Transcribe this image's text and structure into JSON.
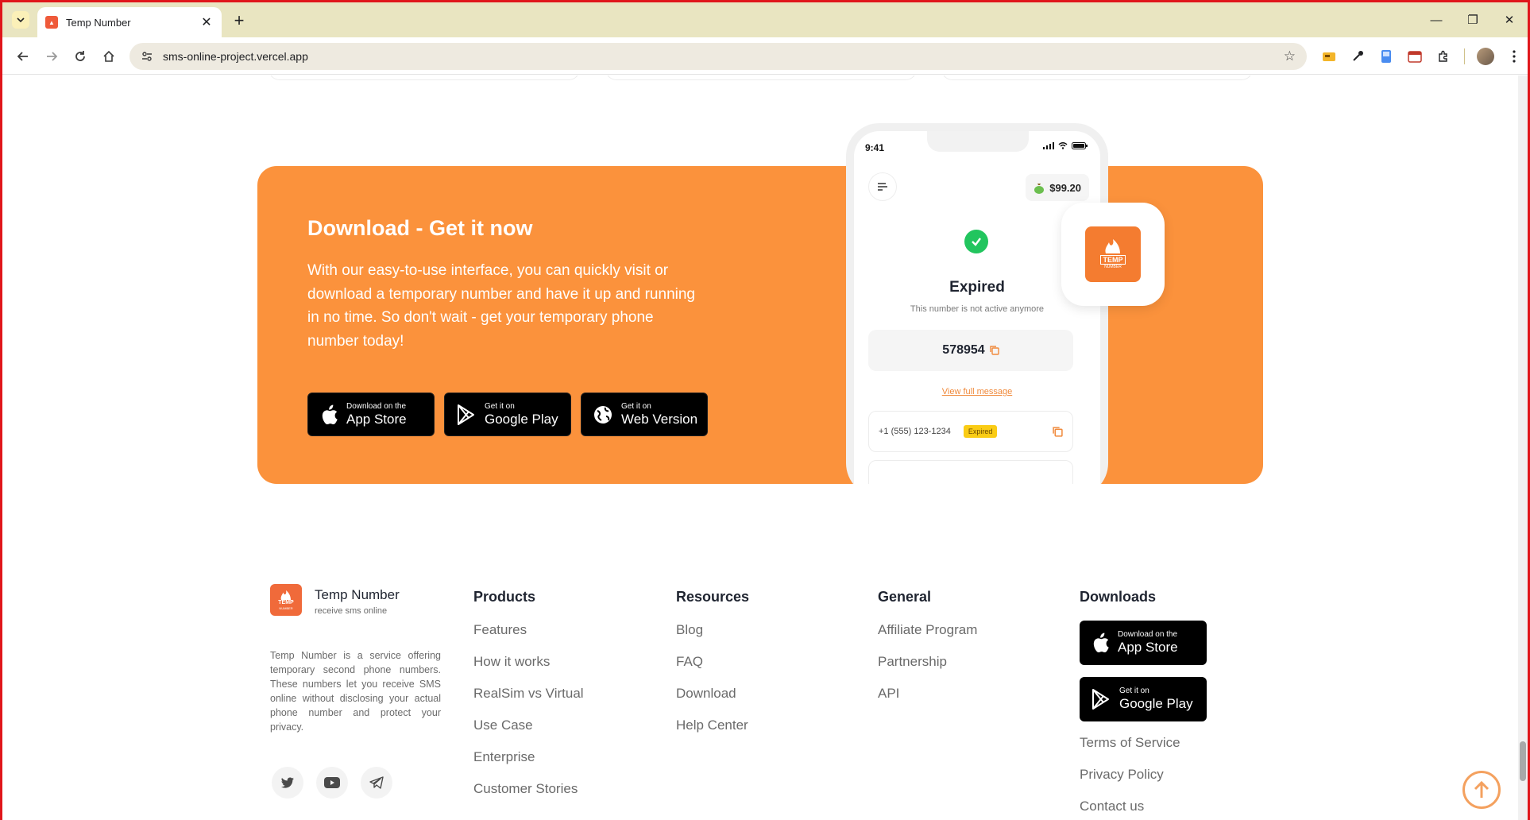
{
  "browser": {
    "tab_title": "Temp Number",
    "url": "sms-online-project.vercel.app"
  },
  "promo": {
    "title": "Download - Get it now",
    "text": "With our easy-to-use interface, you can quickly visit or download a temporary number and have it up and running in no time. So don't wait - get your temporary phone number today!",
    "app_store_small": "Download on the",
    "app_store_big": "App Store",
    "google_play_small": "Get it on",
    "google_play_big": "Google Play",
    "web_small": "Get it on",
    "web_big": "Web Version"
  },
  "phone": {
    "time": "9:41",
    "balance": "$99.20",
    "status_title": "Expired",
    "status_sub": "This number is not active anymore",
    "code": "578954",
    "view_link": "View full message",
    "number": "+1 (555) 123-1234",
    "badge": "Expired",
    "app_tile_label_1": "TEMP",
    "app_tile_label_2": "NUMBER"
  },
  "footer": {
    "brand": "Temp Number",
    "tagline": "receive sms online",
    "logo_label_1": "TEMP",
    "logo_label_2": "NUMBER",
    "description": "Temp Number is a service offering temporary second phone numbers. These numbers let you receive SMS online without disclosing your actual phone number and protect your privacy.",
    "products": {
      "heading": "Products",
      "links": [
        "Features",
        "How it works",
        "RealSim vs Virtual",
        "Use Case",
        "Enterprise",
        "Customer Stories"
      ]
    },
    "resources": {
      "heading": "Resources",
      "links": [
        "Blog",
        "FAQ",
        "Download",
        "Help Center"
      ]
    },
    "general": {
      "heading": "General",
      "links": [
        "Affiliate Program",
        "Partnership",
        "API"
      ]
    },
    "downloads": {
      "heading": "Downloads",
      "app_store_small": "Download on the",
      "app_store_big": "App Store",
      "google_play_small": "Get it on",
      "google_play_big": "Google Play",
      "links": [
        "Terms of Service",
        "Privacy Policy",
        "Contact us"
      ]
    }
  },
  "colors": {
    "promo_bg": "#fb923c",
    "accent": "#f47c30",
    "success": "#22c55e",
    "badge": "#facc15"
  }
}
